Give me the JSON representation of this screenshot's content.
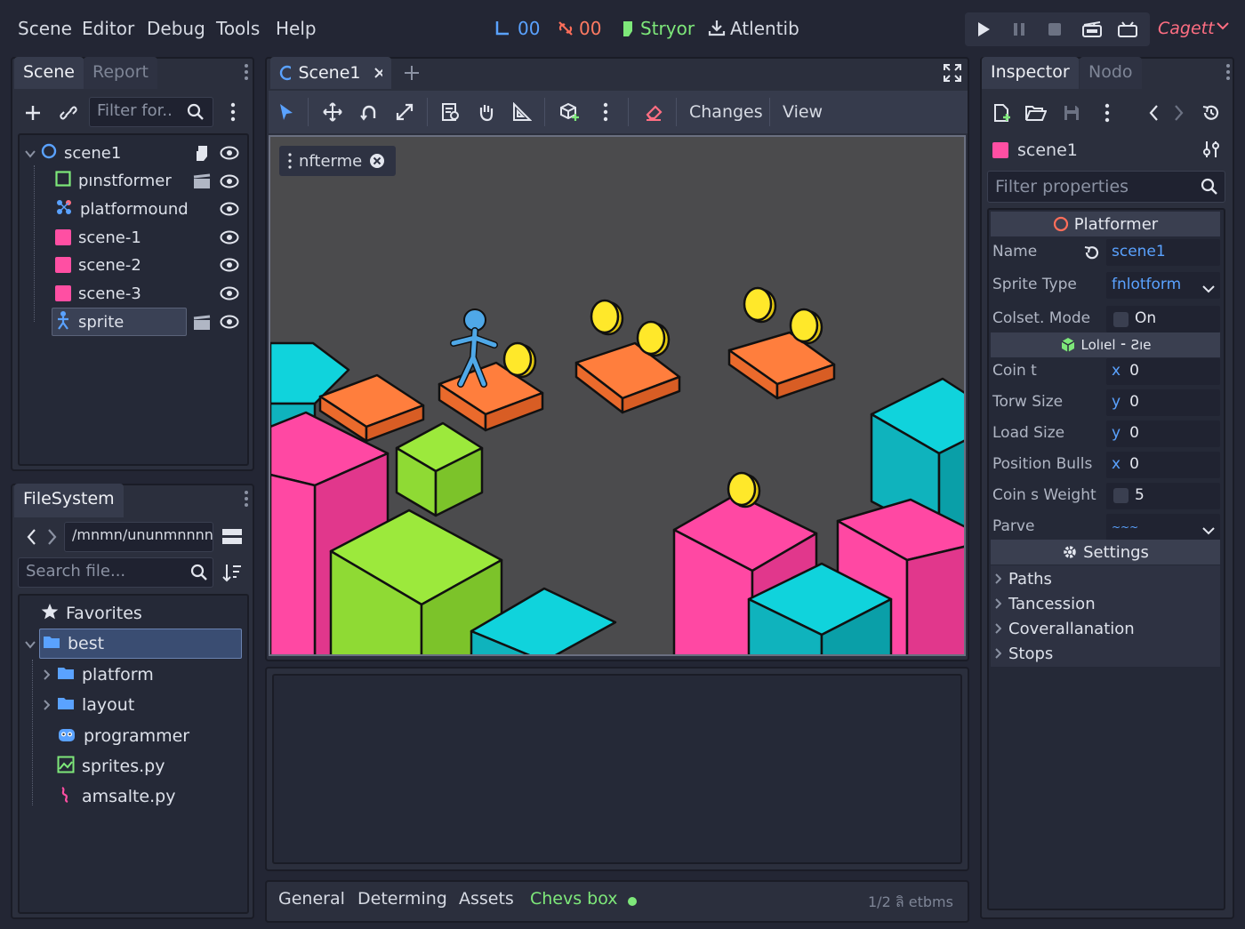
{
  "menu": [
    "Scene",
    "Editor",
    "Debug",
    "Tools",
    "Help"
  ],
  "top_status": {
    "item1": "00",
    "item2": "00",
    "item3": "Stryor",
    "item4": "Atlentib"
  },
  "renderer_label": "Cagett",
  "scene_panel": {
    "tabs": [
      "Scene",
      "Report"
    ],
    "filter_placeholder": "Filter for..",
    "nodes": [
      {
        "label": "scene1",
        "icon": "circle-node-icon"
      },
      {
        "label": "pınstformer",
        "icon": "square-node-icon"
      },
      {
        "label": "platformound",
        "icon": "group-node-icon"
      },
      {
        "label": "scene-1",
        "icon": "pink-square-icon"
      },
      {
        "label": "scene-2",
        "icon": "pink-square-icon"
      },
      {
        "label": "scene-3",
        "icon": "pink-square-icon"
      },
      {
        "label": "sprite",
        "icon": "figure-icon"
      }
    ]
  },
  "filesystem": {
    "title": "FileSystem",
    "path": "/mnmn/ununmnnnn",
    "search_placeholder": "Search file...",
    "items": [
      {
        "label": "Favorites",
        "icon": "star-icon"
      },
      {
        "label": "best",
        "icon": "folder-icon"
      },
      {
        "label": "platform",
        "icon": "folder-icon"
      },
      {
        "label": "layout",
        "icon": "folder-icon"
      },
      {
        "label": "programmer",
        "icon": "godot-icon"
      },
      {
        "label": "sprites.py",
        "icon": "image-file-icon"
      },
      {
        "label": "amsalte.py",
        "icon": "script-icon"
      }
    ]
  },
  "editor": {
    "tab": "Scene1",
    "toolbar_changes": "Changes",
    "toolbar_view": "View",
    "viewport_chip": "nfterme",
    "bottom_tabs": [
      "General",
      "Determing",
      "Assets",
      "Chevs box"
    ],
    "bottom_status": "1/2 ﻿ลิ etbms"
  },
  "inspector": {
    "tabs": [
      "Inspector",
      "Nodo"
    ],
    "node_name": "scene1",
    "filter_placeholder": "Filter properties",
    "section1": "Platformer",
    "props1": [
      {
        "label": "Name",
        "value": "scene1"
      },
      {
        "label": "Sprite Type",
        "value": "fnlotform"
      },
      {
        "label": "Colset. Mode",
        "value": "On"
      }
    ],
    "section2": "Lolıel ⁃ Ƨıe",
    "props2": [
      {
        "label": "Coin t",
        "axis": "x",
        "value": "0"
      },
      {
        "label": "Torw Size",
        "axis": "y",
        "value": "0"
      },
      {
        "label": "Load Size",
        "axis": "y",
        "value": "0"
      },
      {
        "label": "Position Bulls",
        "axis": "x",
        "value": "0"
      },
      {
        "label": "Coin s Weight",
        "axis": "",
        "value": "5"
      },
      {
        "label": "Parve",
        "axis": "",
        "value": "~~~"
      }
    ],
    "section3": "Settings",
    "groups": [
      "Paths",
      "Tancession",
      "Coverallanation",
      "Stops"
    ]
  },
  "colors": {
    "accent": "#5aa2ff",
    "green": "#7ee87a",
    "pink": "#ff4fa3",
    "cyan": "#12d8df",
    "orange": "#ff8240",
    "lime": "#96e83b",
    "coin": "#ffe525",
    "red_label": "#ff6e82"
  }
}
